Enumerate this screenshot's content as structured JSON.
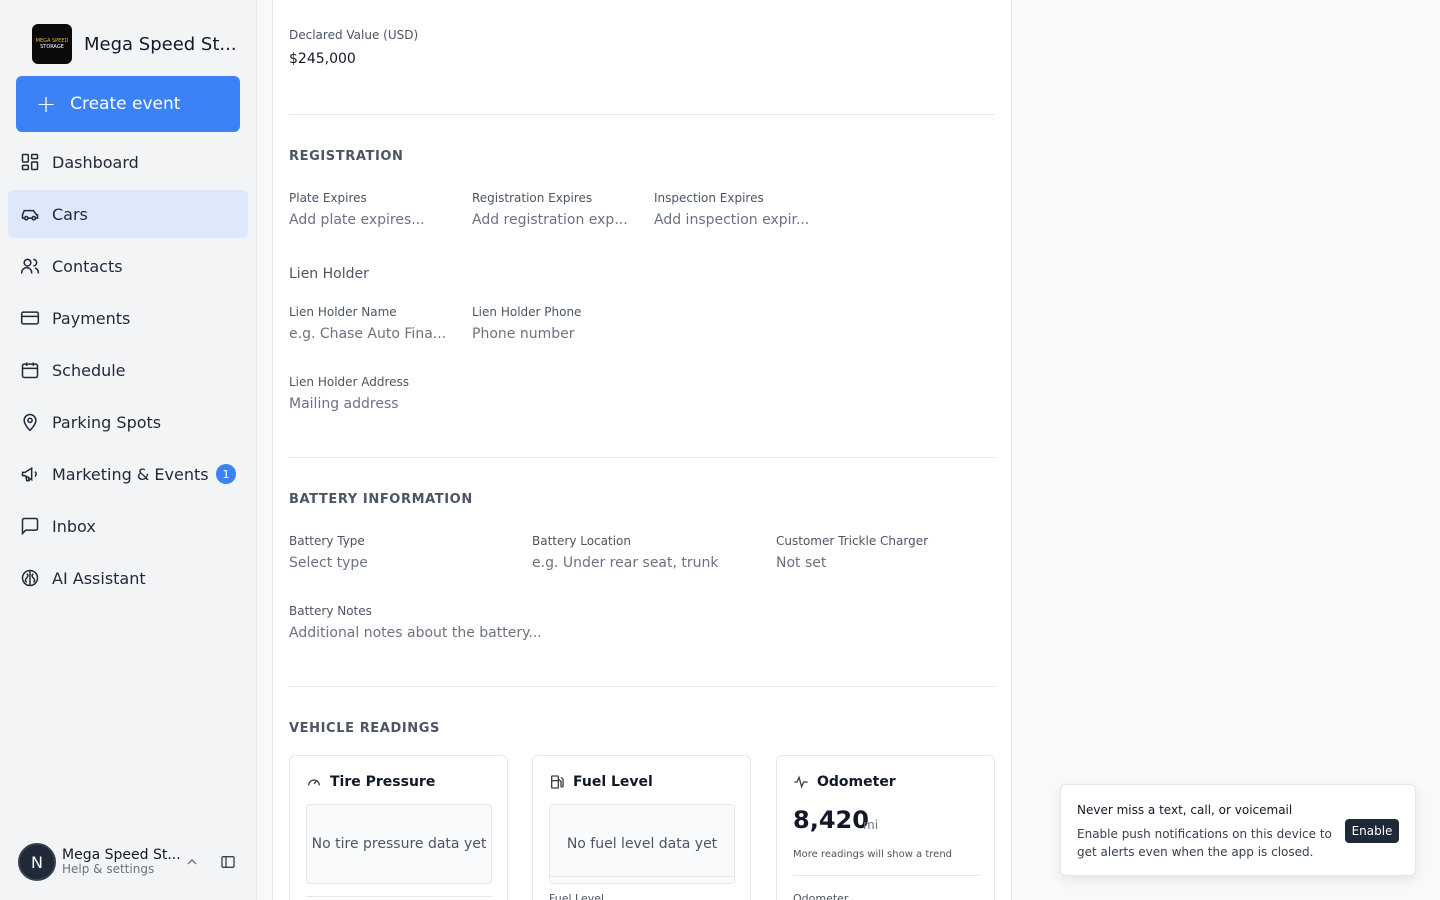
{
  "brand": {
    "name": "Mega Speed St...",
    "logo_line1": "MEGA SPEED",
    "logo_line2": "STORAGE"
  },
  "sidebar": {
    "create_label": "Create event",
    "items": [
      {
        "label": "Dashboard",
        "icon": "dashboard-icon"
      },
      {
        "label": "Cars",
        "icon": "car-icon",
        "active": true
      },
      {
        "label": "Contacts",
        "icon": "users-icon"
      },
      {
        "label": "Payments",
        "icon": "credit-card-icon"
      },
      {
        "label": "Schedule",
        "icon": "calendar-icon"
      },
      {
        "label": "Parking Spots",
        "icon": "map-pin-icon"
      },
      {
        "label": "Marketing & Events",
        "icon": "megaphone-icon",
        "badge": "1"
      },
      {
        "label": "Inbox",
        "icon": "message-square-icon"
      },
      {
        "label": "AI Assistant",
        "icon": "brain-icon"
      }
    ],
    "user": {
      "initial": "N",
      "name": "Mega Speed St...",
      "sub": "Help & settings"
    }
  },
  "declared": {
    "label": "Declared Value (USD)",
    "value": "$245,000"
  },
  "registration": {
    "title": "REGISTRATION",
    "plate_label": "Plate Expires",
    "plate_placeholder": "Add plate expires...",
    "reg_label": "Registration Expires",
    "reg_placeholder": "Add registration exp...",
    "insp_label": "Inspection Expires",
    "insp_placeholder": "Add inspection expir...",
    "lien_heading": "Lien Holder",
    "lien_name_label": "Lien Holder Name",
    "lien_name_placeholder": "e.g. Chase Auto Fina...",
    "lien_phone_label": "Lien Holder Phone",
    "lien_phone_placeholder": "Phone number",
    "lien_addr_label": "Lien Holder Address",
    "lien_addr_placeholder": "Mailing address"
  },
  "battery": {
    "title": "BATTERY INFORMATION",
    "type_label": "Battery Type",
    "type_value": "Select type",
    "location_label": "Battery Location",
    "location_placeholder": "e.g. Under rear seat, trunk",
    "charger_label": "Customer Trickle Charger",
    "charger_value": "Not set",
    "notes_label": "Battery Notes",
    "notes_placeholder": "Additional notes about the battery..."
  },
  "readings": {
    "title": "VEHICLE READINGS",
    "tire": {
      "title": "Tire Pressure",
      "empty": "No tire pressure data yet"
    },
    "fuel": {
      "title": "Fuel Level",
      "empty": "No fuel level data yet",
      "sub": "Fuel Level"
    },
    "odometer": {
      "title": "Odometer",
      "value": "8,420",
      "unit": "mi",
      "hint": "More readings will show a trend",
      "sub": "Odometer"
    }
  },
  "toast": {
    "title": "Never miss a text, call, or voicemail",
    "body": "Enable push notifications on this device to get alerts even when the app is closed.",
    "button": "Enable"
  }
}
